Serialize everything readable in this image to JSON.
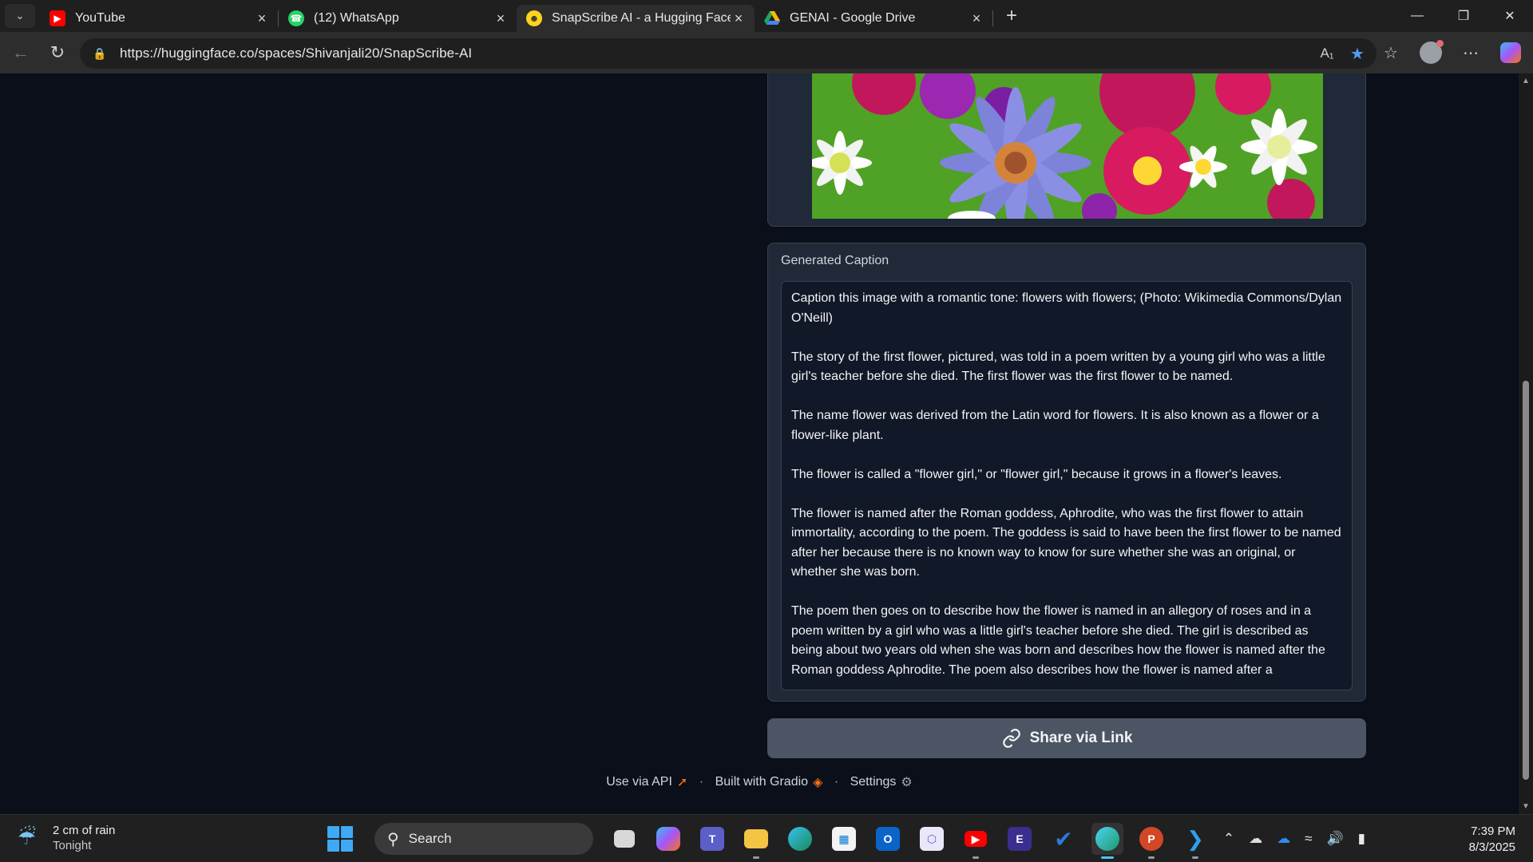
{
  "browser": {
    "tabs": [
      {
        "label": "YouTube",
        "active": false,
        "icon": "youtube-icon",
        "color": "#ff0000"
      },
      {
        "label": "(12) WhatsApp",
        "active": false,
        "icon": "whatsapp-icon",
        "color": "#25d366"
      },
      {
        "label": "SnapScribe AI - a Hugging Face Sp",
        "active": true,
        "icon": "hugging-face-icon",
        "color": "#ffd21e"
      },
      {
        "label": "GENAI - Google Drive",
        "active": false,
        "icon": "google-drive-icon",
        "color": "#1fa463"
      }
    ],
    "url": "https://huggingface.co/spaces/Shivanjali20/SnapScribe-AI"
  },
  "app": {
    "caption_label": "Generated Caption",
    "caption_paragraphs": [
      "Caption this image with a romantic tone: flowers with flowers; (Photo: Wikimedia Commons/Dylan O'Neill)",
      "The story of the first flower, pictured, was told in a poem written by a young girl who was a little girl's teacher before she died. The first flower was the first flower to be named.",
      "The name flower was derived from the Latin word for flowers. It is also known as a flower or a flower-like plant.",
      "The flower is called a \"flower girl,\" or \"flower girl,\" because it grows in a flower's leaves.",
      "The flower is named after the Roman goddess, Aphrodite, who was the first flower to attain immortality, according to the poem. The goddess is said to have been the first flower to be named after her because there is no known way to know for sure whether she was an original, or whether she was born.",
      "The poem then goes on to describe how the flower is named in an allegory of roses and in a poem written by a girl who was a little girl's teacher before she died. The girl is described as being about two years old when she was born and describes how the flower is named after the Roman goddess Aphrodite. The poem also describes how the flower is named after a"
    ],
    "share_label": "Share via Link",
    "footer": {
      "api": "Use via API",
      "gradio": "Built with Gradio",
      "settings": "Settings",
      "separator": "·"
    }
  },
  "taskbar": {
    "weather_main": "2 cm of rain",
    "weather_sub": "Tonight",
    "search_label": "Search",
    "time": "7:39 PM",
    "date": "8/3/2025"
  }
}
